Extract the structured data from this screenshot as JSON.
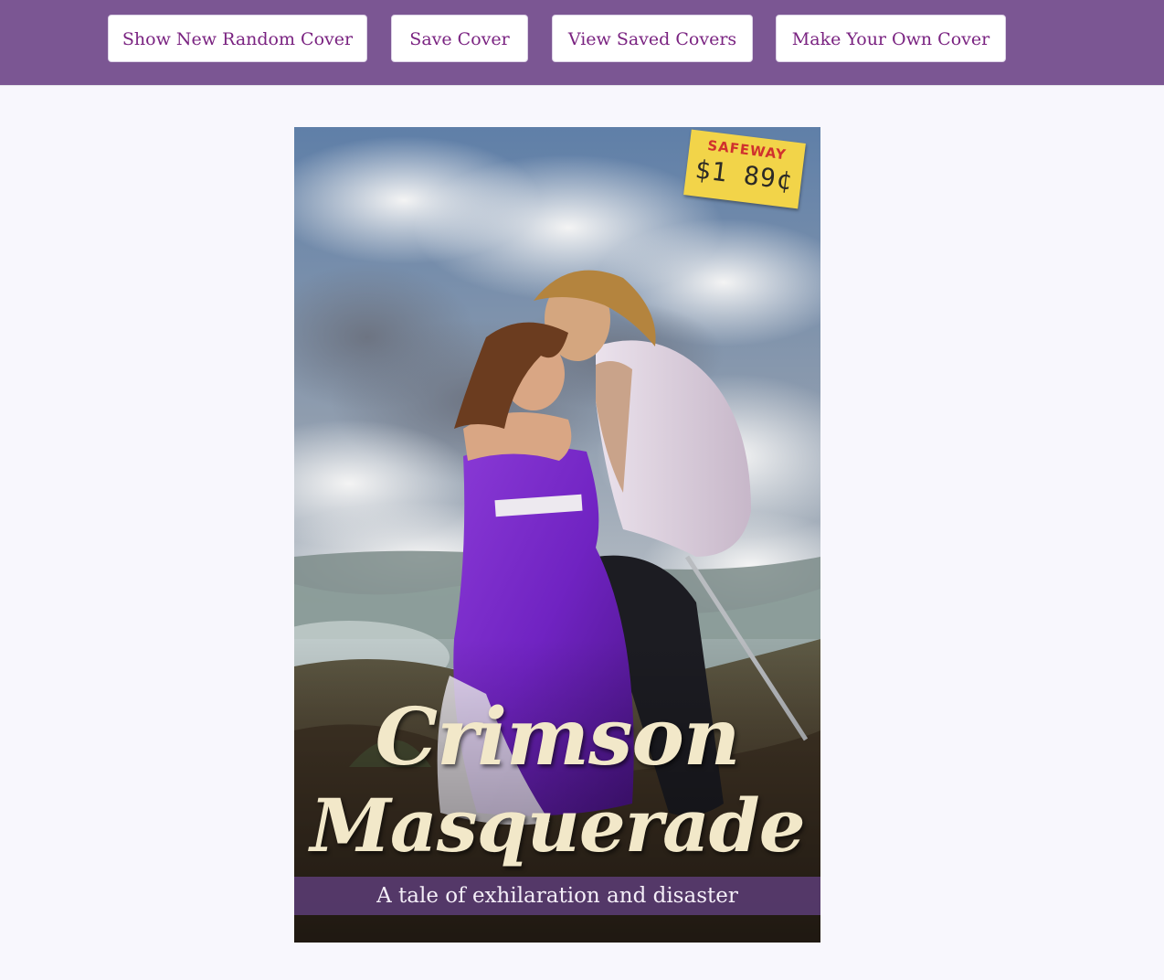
{
  "nav": {
    "show_random_label": "Show New Random Cover",
    "save_label": "Save Cover",
    "view_saved_label": "View Saved Covers",
    "make_own_label": "Make Your Own Cover"
  },
  "cover": {
    "title_line1": "Crimson",
    "title_line2": "Masquerade",
    "tagline": "A tale of exhilaration and disaster",
    "sticker": {
      "brand": "SAFEWAY",
      "price": "$1 89¢"
    }
  },
  "colors": {
    "header_bg": "#7b5693",
    "button_text": "#7a2381",
    "page_bg": "#f8f7fd",
    "title_text": "#f2e8c9",
    "tagline_band": "#624080"
  }
}
